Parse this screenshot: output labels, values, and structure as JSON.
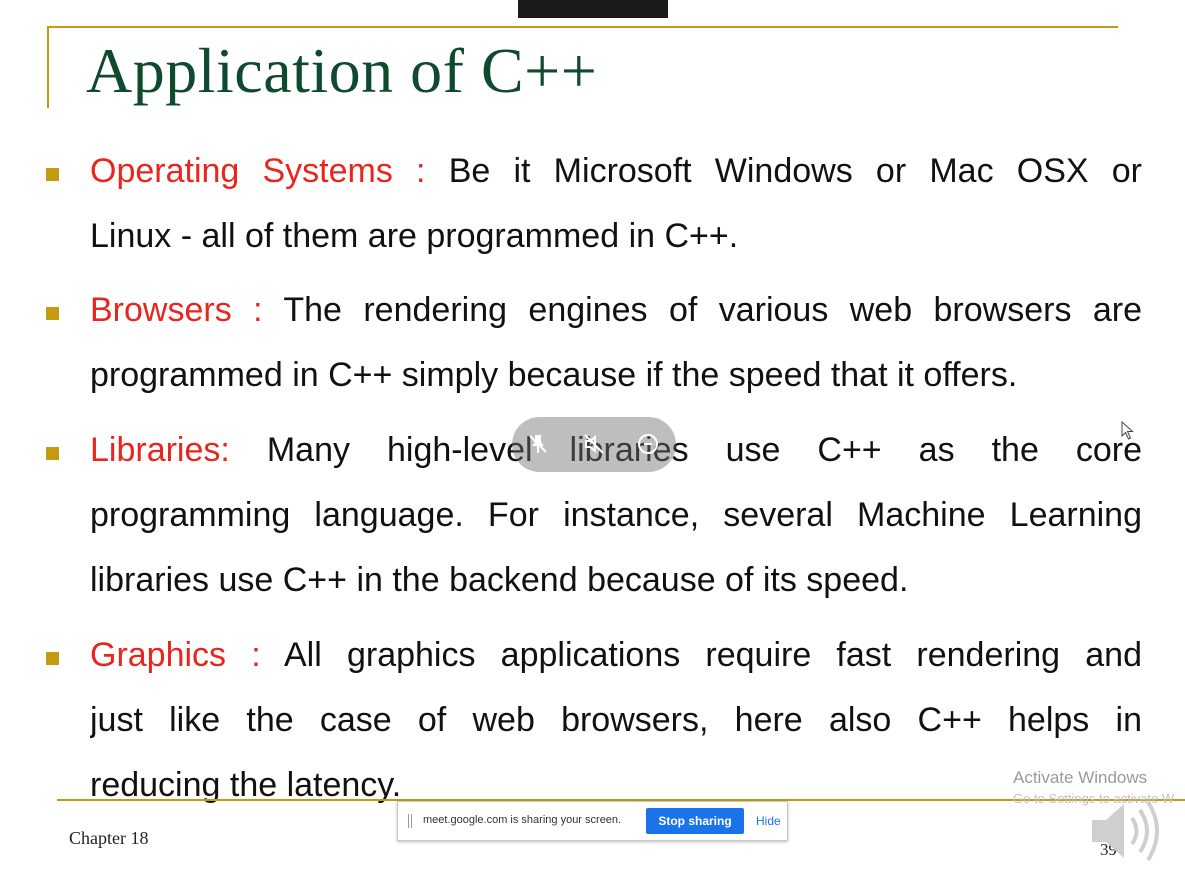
{
  "slide": {
    "title": "Application of C++",
    "items": [
      {
        "keyword": "Operating Systems :",
        "lines": [
          " Be it Microsoft Windows or Mac OSX or",
          "Linux - all of them are programmed in C++."
        ]
      },
      {
        "keyword": "Browsers :",
        "lines": [
          " The rendering engines of various web browsers are",
          "programmed in C++ simply because if the speed that it offers."
        ]
      },
      {
        "keyword": "Libraries:",
        "lines": [
          " Many high-level libraries use C++ as the core",
          "programming language. For instance, several Machine Learning",
          "libraries use C++ in the backend because of its speed."
        ]
      },
      {
        "keyword": "Graphics :",
        "lines": [
          " All graphics applications require fast rendering and",
          "just like the case of web browsers, here also C++ helps in",
          "reducing the latency."
        ]
      }
    ],
    "footer": "Chapter 18",
    "page_number": "39"
  },
  "watermark": {
    "title": "Activate Windows",
    "subtitle": "Go to Settings to activate W"
  },
  "share_bar": {
    "message": "meet.google.com is sharing your screen.",
    "stop_label": "Stop sharing",
    "hide_label": "Hide"
  },
  "overlay_controls": [
    "unpin-icon",
    "mute-icon",
    "minimize-icon"
  ],
  "icons": {
    "bullet": "square-bullet-icon",
    "speaker": "speaker-icon",
    "cursor": "mouse-cursor-icon"
  },
  "colors": {
    "accent": "#c49a10",
    "title": "#0f4a2e",
    "keyword": "#e8261e",
    "body_text": "#111111",
    "stop_button": "#1a73e8"
  }
}
